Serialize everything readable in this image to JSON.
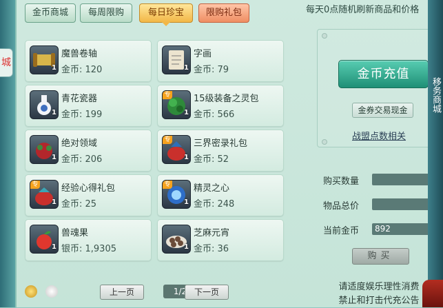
{
  "tabs": [
    {
      "label": "金币商城"
    },
    {
      "label": "每周限购"
    },
    {
      "label": "每日珍宝"
    },
    {
      "label": "限购礼包"
    }
  ],
  "notice_top": "每天0点随机刷新商品和价格",
  "left_edge_text": "城",
  "right_edge_text": "移务商城",
  "items": [
    {
      "name": "魔兽卷轴",
      "price": "金币: 120",
      "qty": "1",
      "special": "",
      "icon": "scroll-icon"
    },
    {
      "name": "字画",
      "price": "金币: 79",
      "qty": "1",
      "special": "",
      "icon": "painting-icon"
    },
    {
      "name": "青花瓷器",
      "price": "金币: 199",
      "qty": "1",
      "special": "",
      "icon": "vase-icon"
    },
    {
      "name": "15级装备之灵包",
      "price": "金币: 566",
      "qty": "1",
      "special": "专",
      "icon": "spirit-bag-icon"
    },
    {
      "name": "绝对领域",
      "price": "金币: 206",
      "qty": "1",
      "special": "",
      "icon": "domain-bag-icon"
    },
    {
      "name": "三界密录礼包",
      "price": "金币: 52",
      "qty": "1",
      "special": "专",
      "icon": "gift-bag-icon"
    },
    {
      "name": "经验心得礼包",
      "price": "金币: 25",
      "qty": "1",
      "special": "专",
      "icon": "exp-bag-icon"
    },
    {
      "name": "精灵之心",
      "price": "金币: 248",
      "qty": "1",
      "special": "专",
      "icon": "spirit-heart-icon"
    },
    {
      "name": "兽魂果",
      "price": "银币: 1,9305",
      "qty": "1",
      "special": "",
      "icon": "fruit-icon"
    },
    {
      "name": "芝麻元宵",
      "price": "金币: 36",
      "qty": "1",
      "special": "",
      "icon": "dumpling-icon"
    }
  ],
  "pagination": {
    "prev": "上一页",
    "page": "1/2",
    "next": "下一页"
  },
  "right": {
    "recharge_label": "金币充值",
    "trade_label": "金券交易现金",
    "league_label": "战盟点数相关"
  },
  "purchase": {
    "qty_label": "购买数量",
    "qty_value": "",
    "total_label": "物品总价",
    "total_value": "",
    "current_label": "当前金币",
    "current_value": "892",
    "buy_label": "购买"
  },
  "notice_bottom": [
    "请适度娱乐理性消费",
    "禁止和打击代充公告"
  ]
}
